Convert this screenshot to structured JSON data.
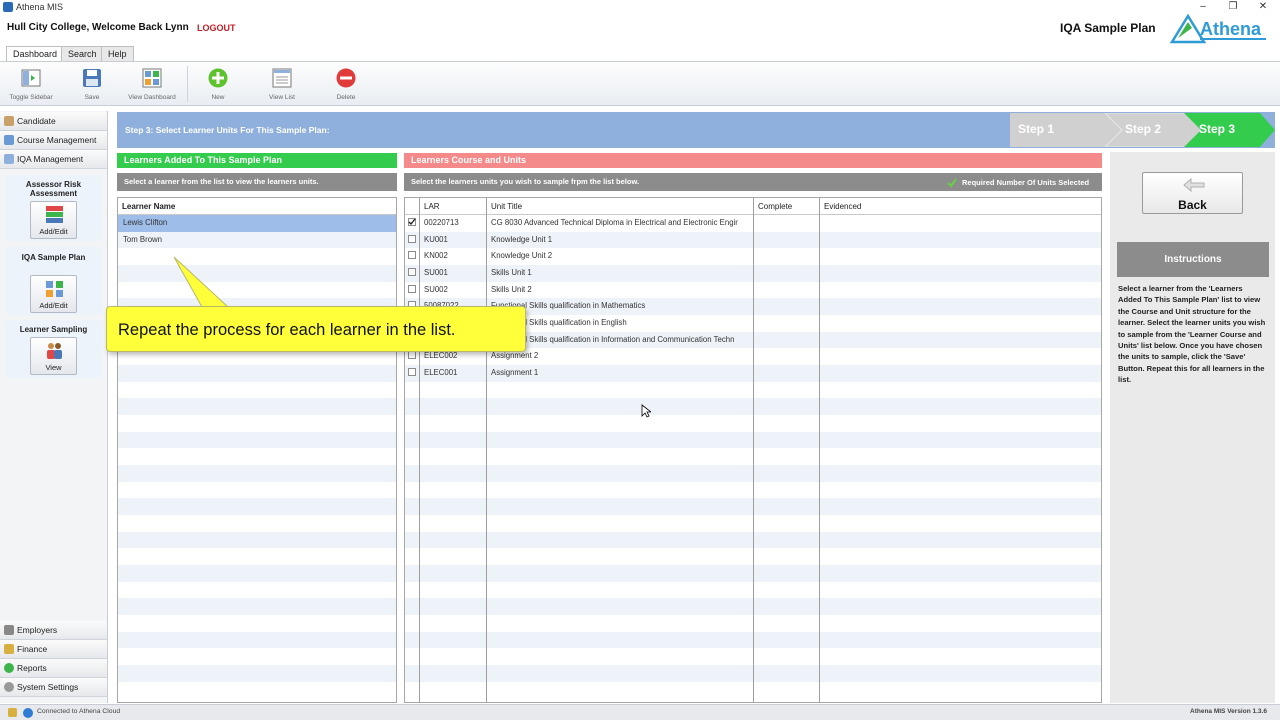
{
  "window": {
    "title": "Athena MIS",
    "controls": [
      "–",
      "❐",
      "✕"
    ]
  },
  "header": {
    "welcome": "Hull City College,  Welcome Back Lynn",
    "logout": "LOGOUT",
    "page_title": "IQA Sample Plan",
    "logo_text": "Athena"
  },
  "menu_tabs": [
    "Dashboard",
    "Search",
    "Help"
  ],
  "toolbar": {
    "toggle_sidebar": "Toggle Sidebar",
    "save": "Save",
    "view_dashboard": "View Dashboard",
    "new": "New",
    "view_list": "View List",
    "delete": "Delete"
  },
  "sidebar": {
    "top_items": [
      "Candidate",
      "Course Management",
      "IQA Management"
    ],
    "panels": {
      "assessor_title": "Assessor Risk Assessment",
      "assessor_button": "Add/Edit",
      "iqa_title": "IQA Sample Plan",
      "iqa_button": "Add/Edit",
      "sampling_title": "Learner Sampling",
      "sampling_button": "View"
    },
    "bottom_items": [
      "Employers",
      "Finance",
      "Reports",
      "System Settings"
    ]
  },
  "stepbar": {
    "text": "Step 3:  Select Learner Units For This Sample Plan:",
    "steps": [
      "Step 1",
      "Step 2",
      "Step 3"
    ],
    "active_step": 3
  },
  "learners_panel": {
    "header": "Learners Added To This Sample Plan",
    "subheader": "Select a learner from the list to view the learners units.",
    "column": "Learner Name",
    "rows": [
      "Lewis Clifton",
      "Tom Brown"
    ],
    "selected_index": 0
  },
  "units_panel": {
    "header": "Learners Course and Units",
    "subheader": "Select the learners units you wish to sample frpm the list below.",
    "required_note": "Required Number Of Units Selected",
    "columns": [
      "LAR",
      "Unit Title",
      "Complete",
      "Evidenced"
    ],
    "rows": [
      {
        "lar": "00220713",
        "title": "CG 8030 Advanced Technical Diploma in Electrical and Electronic Engir",
        "checked": true
      },
      {
        "lar": "KU001",
        "title": "Knowledge Unit 1",
        "checked": false
      },
      {
        "lar": "KN002",
        "title": "Knowledge Unit 2",
        "checked": false
      },
      {
        "lar": "SU001",
        "title": "Skills Unit 1",
        "checked": false
      },
      {
        "lar": "SU002",
        "title": "Skills Unit 2",
        "checked": false
      },
      {
        "lar": "50087022",
        "title": "Functional Skills qualification in Mathematics",
        "checked": false
      },
      {
        "lar": "",
        "title": "Functional Skills qualification in English",
        "checked": false
      },
      {
        "lar": "",
        "title": "Functional Skills qualification in Information and Communication Techn",
        "checked": false
      },
      {
        "lar": "ELEC002",
        "title": "Assignment 2",
        "checked": false
      },
      {
        "lar": "ELEC001",
        "title": "Assignment 1",
        "checked": false
      }
    ]
  },
  "right_panel": {
    "back_label": "Back",
    "instructions_title": "Instructions",
    "instructions_text": "Select a learner from the 'Learners Added To This Sample Plan' list to view the Course and Unit structure for the learner. Select the learner units you wish to sample from the 'Learner Course and Units' list below. Once you have chosen the units to sample, click the 'Save' Button. Repeat this for all learners in the list."
  },
  "callout": {
    "text": "Repeat the process for each learner in the list."
  },
  "status": {
    "connection": "Connected to Athena Cloud",
    "version": "Athena MIS Version 1.3.6"
  },
  "colors": {
    "green": "#33cc4c",
    "salmon": "#f58a8a",
    "steel": "#8fb0dc",
    "callout": "#ffff3a"
  }
}
